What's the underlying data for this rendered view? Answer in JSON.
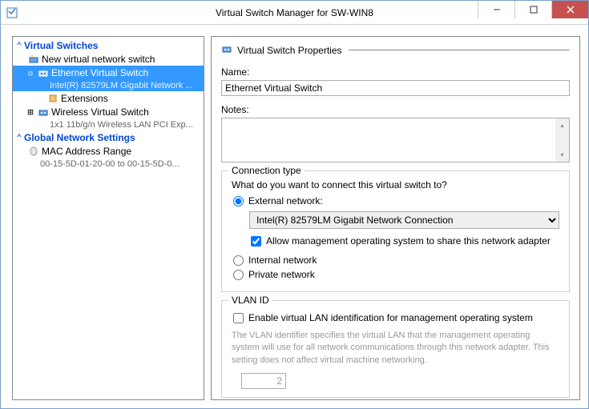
{
  "titlebar": {
    "title": "Virtual Switch Manager for SW-WIN8"
  },
  "tree": {
    "virtual_switches_header": "Virtual Switches",
    "new_switch": "New virtual network switch",
    "eth_switch": "Ethernet Virtual Switch",
    "eth_switch_detail": "Intel(R) 82579LM Gigabit Network ...",
    "extensions": "Extensions",
    "wireless_switch": "Wireless Virtual Switch",
    "wireless_detail": "1x1 11b/g/n Wireless LAN PCI Exp...",
    "global_header": "Global Network Settings",
    "mac_range": "MAC Address Range",
    "mac_detail": "00-15-5D-01-20-00 to 00-15-5D-0..."
  },
  "props": {
    "header": "Virtual Switch Properties",
    "name_label": "Name:",
    "name_value": "Ethernet Virtual Switch",
    "notes_label": "Notes:",
    "notes_value": "",
    "conn": {
      "legend": "Connection type",
      "prompt": "What do you want to connect this virtual switch to?",
      "external_label": "External network:",
      "adapter_selected": "Intel(R) 82579LM Gigabit Network Connection",
      "allow_mgmt": "Allow management operating system to share this network adapter",
      "internal_label": "Internal network",
      "private_label": "Private network"
    },
    "vlan": {
      "legend": "VLAN ID",
      "enable_label": "Enable virtual LAN identification for management operating system",
      "help": "The VLAN identifier specifies the virtual LAN that the management operating system will use for all network communications through this network adapter. This setting does not affect virtual machine networking.",
      "value": "2"
    }
  }
}
